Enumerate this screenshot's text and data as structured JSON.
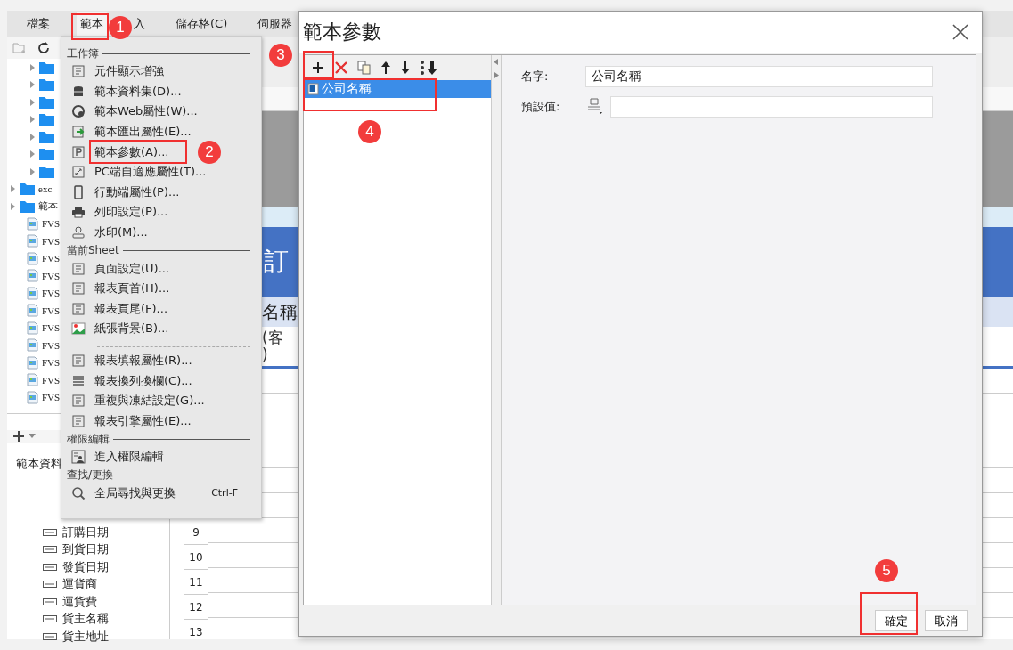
{
  "menu_bar": [
    {
      "label": "檔案",
      "selected": false
    },
    {
      "label": "範本",
      "selected": true
    },
    {
      "label": "入",
      "selected": false
    },
    {
      "label": "儲存格(C)",
      "selected": false
    },
    {
      "label": "伺服器",
      "selected": false
    }
  ],
  "file_tree": [
    {
      "kind": "subfolder",
      "expanded": false
    },
    {
      "kind": "subfolder",
      "expanded": false
    },
    {
      "kind": "subfolder",
      "expanded": false
    },
    {
      "kind": "subfolder",
      "expanded": false
    },
    {
      "kind": "subfolder",
      "expanded": false
    },
    {
      "kind": "subfolder",
      "expanded": false
    },
    {
      "kind": "subfolder",
      "expanded": false
    },
    {
      "kind": "folder",
      "label": "exc",
      "expanded": false
    },
    {
      "kind": "folder",
      "label": "範本",
      "expanded": false
    },
    {
      "kind": "file",
      "label": "FVS"
    },
    {
      "kind": "file",
      "label": "FVS"
    },
    {
      "kind": "file",
      "label": "FVS"
    },
    {
      "kind": "file",
      "label": "FVS"
    },
    {
      "kind": "file",
      "label": "FVS"
    },
    {
      "kind": "file",
      "label": "FVS"
    },
    {
      "kind": "file",
      "label": "FVS"
    },
    {
      "kind": "file",
      "label": "FVS"
    },
    {
      "kind": "file",
      "label": "FVS"
    },
    {
      "kind": "file",
      "label": "FVS"
    },
    {
      "kind": "file",
      "label": "FVS"
    }
  ],
  "datasource_panel": {
    "title": "範本資料",
    "fields": [
      "訂購日期",
      "到貨日期",
      "發貨日期",
      "運貨商",
      "運貨費",
      "貨主名稱",
      "貨主地址"
    ]
  },
  "sheet": {
    "title_fragment": "訂",
    "header_fragment": "名稱",
    "cell_fragment": "(客",
    "cell_fragment_2": ")",
    "row_numbers": [
      "9",
      "10",
      "11",
      "12",
      "13"
    ]
  },
  "template_menu": {
    "sections": [
      {
        "title": "工作簿",
        "items": [
          {
            "kind": "command",
            "label": "元件顯示增強"
          },
          {
            "kind": "command",
            "label": "範本資料集(D)..."
          },
          {
            "kind": "command",
            "label": "範本Web屬性(W)..."
          },
          {
            "kind": "command",
            "label": "範本匯出屬性(E)..."
          },
          {
            "kind": "command",
            "label": "範本參數(A)..."
          },
          {
            "kind": "command",
            "label": "PC端自適應屬性(T)..."
          },
          {
            "kind": "command",
            "label": "行動端屬性(P)..."
          },
          {
            "kind": "command",
            "label": "列印設定(P)..."
          },
          {
            "kind": "command",
            "label": "水印(M)..."
          }
        ]
      },
      {
        "title": "當前Sheet",
        "items": [
          {
            "kind": "command",
            "label": "頁面設定(U)..."
          },
          {
            "kind": "command",
            "label": "報表頁首(H)..."
          },
          {
            "kind": "command",
            "label": "報表頁尾(F)..."
          },
          {
            "kind": "command",
            "label": "紙張背景(B)..."
          },
          {
            "kind": "separator"
          },
          {
            "kind": "command",
            "label": "報表填報屬性(R)..."
          },
          {
            "kind": "command",
            "label": "報表換列換欄(C)..."
          },
          {
            "kind": "command",
            "label": "重複與凍結設定(G)..."
          },
          {
            "kind": "command",
            "label": "報表引擎屬性(E)..."
          }
        ]
      },
      {
        "title": "權限編輯",
        "items": [
          {
            "kind": "command",
            "label": "進入權限編輯"
          }
        ]
      },
      {
        "title": "查找/更換",
        "items": [
          {
            "kind": "command",
            "label": "全局尋找與更換",
            "shortcut": "Ctrl-F"
          }
        ]
      }
    ]
  },
  "dialog": {
    "title": "範本參數",
    "parameters": [
      {
        "label": "公司名稱",
        "selected": true
      }
    ],
    "name_label": "名字:",
    "name_value": "公司名稱",
    "default_label": "預設值:",
    "buttons": [
      {
        "label": "確定"
      },
      {
        "label": "取消"
      }
    ]
  },
  "annotations": {
    "steps": [
      "1",
      "2",
      "3",
      "4",
      "5"
    ]
  }
}
